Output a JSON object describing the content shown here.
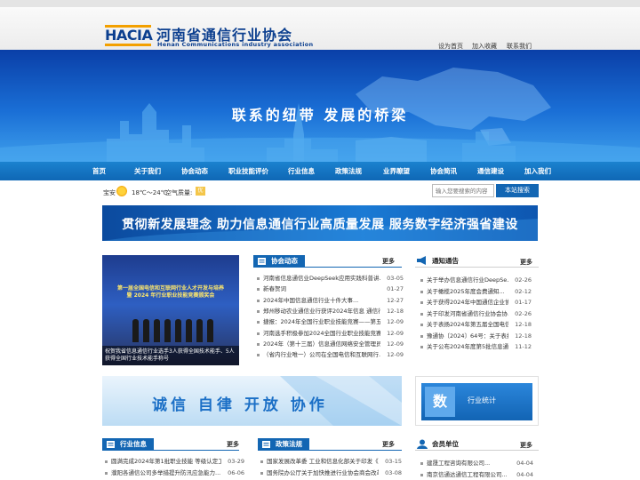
{
  "header": {
    "logo": "HACIA",
    "name": "河南省通信行业协会",
    "name_en": "Henan Communications industry association",
    "links": [
      "设为首页",
      "加入收藏",
      "联系我们"
    ]
  },
  "banner": {
    "slogan": "联系的纽带   发展的桥梁"
  },
  "nav": {
    "items": [
      "首页",
      "关于我们",
      "协会动态",
      "职业技能评价",
      "行业信息",
      "政策法规",
      "业界瞭望",
      "协会简讯",
      "通信建设",
      "加入我们"
    ]
  },
  "weather": {
    "city": "宝安",
    "temp": "18℃～24℃",
    "aqi_label": "空气质量:",
    "aqi_value": "优"
  },
  "search": {
    "placeholder": "输入您要搜索的内容",
    "button": "本站搜索"
  },
  "slogan_bar": {
    "text": "贯彻新发展理念 助力信息通信行业高质量发展 服务数字经济强省建设"
  },
  "photo": {
    "title_line1": "第一届全国电信和互联网行业人才开发与培养",
    "title_line2": "暨 2024 年行业职业技能竞赛颁奖会",
    "caption_line1": "祝贺我省信息通信行业选手3人获得全国技术能手、5人",
    "caption_line2": "获得全国行业技术能手称号"
  },
  "news": {
    "title": "协会动态",
    "more": "更多",
    "items": [
      {
        "t": "河南省信息通信业DeepSeek应用实践科普讲...",
        "d": "03-05"
      },
      {
        "t": "新春贺词",
        "d": "01-27"
      },
      {
        "t": "2024年中国信息通信行业十件大事...",
        "d": "12-27"
      },
      {
        "t": "郑州移动农业通信业行获评2024年信息 通信行...",
        "d": "12-18"
      },
      {
        "t": "捷报：2024年全国行业职业技能竞赛——第五...",
        "d": "12-09"
      },
      {
        "t": "河南选手积极参加2024全国行业职业技能竞赛...",
        "d": "12-09"
      },
      {
        "t": "2024年（第十三届）信息通信网络安全管理员...",
        "d": "12-09"
      },
      {
        "t": "（省内行业唯一）公司在全国电信和互联网行...",
        "d": "12-09"
      }
    ]
  },
  "notice": {
    "title": "通知通告",
    "more": "更多",
    "items": [
      {
        "t": "关于举办信息通信行业DeepSe...",
        "d": "02-26"
      },
      {
        "t": "关于橄榄2025年度会费通知...",
        "d": "02-12"
      },
      {
        "t": "关于获得2024年中国通信企业协...",
        "d": "01-17"
      },
      {
        "t": "关于印发河南省通信行业协会协...",
        "d": "02-26"
      },
      {
        "t": "关于表扬2024年第五届全国电信...",
        "d": "12-18"
      },
      {
        "t": "豫通协〔2024〕64号：关于表扬...",
        "d": "12-18"
      },
      {
        "t": "关于公布2024年度第5批信息通...",
        "d": "11-12"
      }
    ]
  },
  "banner2": {
    "text": "诚信  自律  开放  协作"
  },
  "stat": {
    "icon_char": "数",
    "label": "行业统计"
  },
  "industry": {
    "title": "行业信息",
    "more": "更多",
    "items": [
      {
        "t": "圆满完成2024年第1批职业技能 等级认定工作...",
        "d": "03-29"
      },
      {
        "t": "濮阳各通信公司多举措提升防汛应急能力...",
        "d": "06-06"
      }
    ]
  },
  "policy": {
    "title": "政策法规",
    "more": "更多",
    "items": [
      {
        "t": "国家发展改革委 工业和信息化部关于印发《...",
        "d": "03-15"
      },
      {
        "t": "国务院办公厅关于加快推进行业协会商会改革...",
        "d": "03-08"
      }
    ]
  },
  "members": {
    "title": "会员单位",
    "more": "更多",
    "items": [
      {
        "t": "建晟工程咨询有限公司...",
        "d": "04-04"
      },
      {
        "t": "南京信通达通信工程有限公司...",
        "d": "04-04"
      }
    ]
  }
}
